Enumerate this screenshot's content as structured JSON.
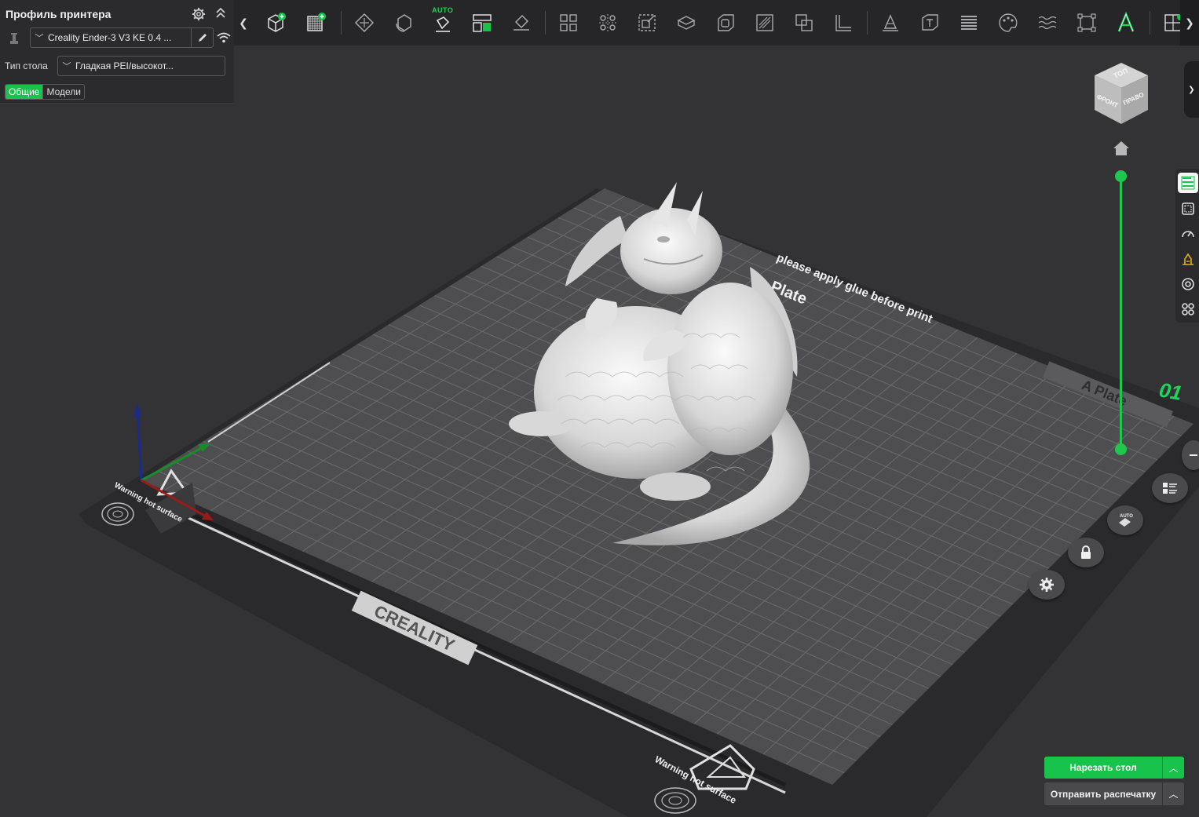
{
  "left_panel": {
    "title": "Профиль принтера",
    "printer": "Creality Ender-3 V3 KE 0.4 ...",
    "bed_label": "Тип стола",
    "bed_value": "Гладкая PEI/высокот...",
    "tabs": [
      "Общие",
      "Модели"
    ]
  },
  "toolbar": {
    "auto_label": "AUTO",
    "icons": [
      "add-object-icon",
      "add-plate-icon",
      "orient-icon",
      "arrange-icon",
      "auto-orient-icon",
      "split-view-icon",
      "lay-on-face-icon",
      "layout-grid-icon",
      "distribute-icon",
      "scale-icon",
      "support-icon",
      "hollow-icon",
      "drill-icon",
      "boolean-icon",
      "measure-icon",
      "seam-icon",
      "text-emboss-icon",
      "variable-layer-icon",
      "paint-icon",
      "fuzzy-skin-icon",
      "cut-icon",
      "text-icon",
      "assembly-icon"
    ]
  },
  "viewcube": {
    "top": "ТОП",
    "front": "ФРОНТ",
    "right": "ПРАВО"
  },
  "bed": {
    "brand": "CREALITY",
    "warning": "Warning hot surface",
    "glue_text": "please apply glue before print",
    "side_text": "A Plate",
    "plate_text": "Plate",
    "plate_number": "01"
  },
  "plate_buttons": [
    "list-icon",
    "auto-arrange-icon",
    "lock-icon",
    "settings-icon"
  ],
  "auto_badge": "AUTO",
  "actions": {
    "slice": "Нарезать стол",
    "send": "Отправить распечатку"
  },
  "colors": {
    "accent": "#17c34a",
    "background": "#333336",
    "panel": "#2b2b2e"
  }
}
